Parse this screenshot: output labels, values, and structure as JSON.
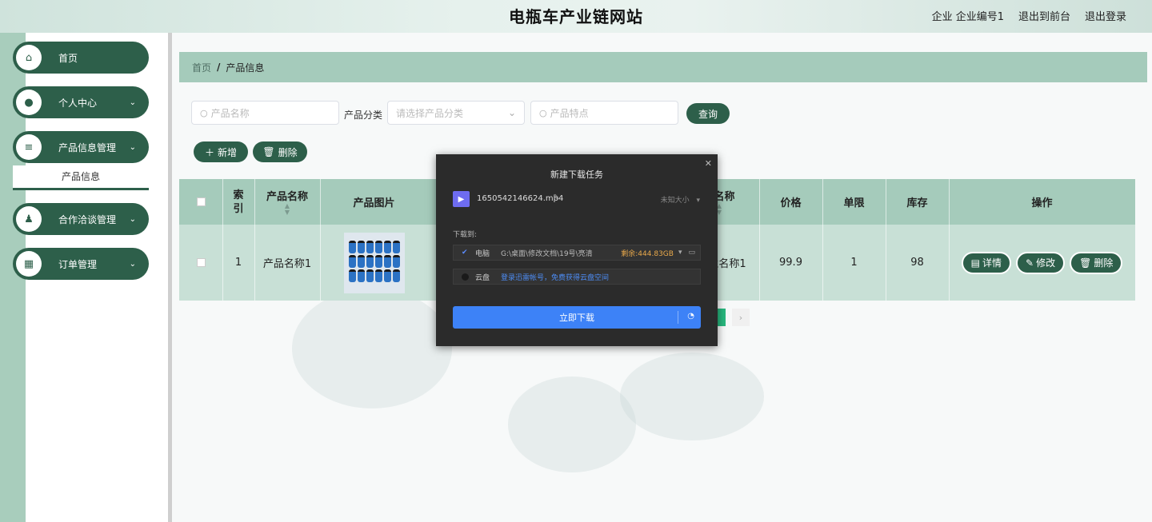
{
  "header": {
    "title": "电瓶车产业链网站",
    "links": [
      "企业 企业编号1",
      "退出到前台",
      "退出登录"
    ]
  },
  "sidebar": {
    "items": [
      {
        "label": "首页",
        "icon": "home-icon"
      },
      {
        "label": "个人中心",
        "icon": "user-icon"
      },
      {
        "label": "产品信息管理",
        "icon": "sliders-icon"
      },
      {
        "label": "合作洽谈管理",
        "icon": "person-icon"
      },
      {
        "label": "订单管理",
        "icon": "grid-icon"
      }
    ],
    "submenu_active": "产品信息"
  },
  "breadcrumb": {
    "home": "首页",
    "sep": "/",
    "current": "产品信息"
  },
  "search": {
    "name_placeholder": "产品名称",
    "category_label": "产品分类",
    "category_placeholder": "请选择产品分类",
    "feature_placeholder": "产品特点",
    "query_button": "查询"
  },
  "toolbar": {
    "add_label": "新增",
    "delete_label": "删除"
  },
  "table": {
    "headers": {
      "index": "索引",
      "name": "产品名称",
      "image": "产品图片",
      "company": "业名称",
      "price": "价格",
      "limit": "单限",
      "stock": "库存",
      "actions": "操作"
    },
    "rows": [
      {
        "index": "1",
        "name": "产品名称1",
        "company": "业名称1",
        "price": "99.9",
        "limit": "1",
        "stock": "98"
      }
    ],
    "action_labels": {
      "detail": "详情",
      "edit": "修改",
      "delete": "删除"
    }
  },
  "download_dialog": {
    "title": "新建下载任务",
    "file_name": "1650542146624.mp4",
    "file_size": "未知大小",
    "save_to_label": "下载到:",
    "local": {
      "name": "电脑",
      "path": "G:\\桌面\\修改文档\\19号\\亮清",
      "free": "剩余:444.83GB"
    },
    "cloud": {
      "name": "云盘",
      "hint": "登录迅雷帐号，免费获得云盘空间"
    },
    "download_button": "立即下载"
  },
  "colors": {
    "primary": "#2d5f4a",
    "header_row": "#a5cbbb",
    "body_row": "#c8e0d6",
    "accent": "#3d82f7"
  }
}
